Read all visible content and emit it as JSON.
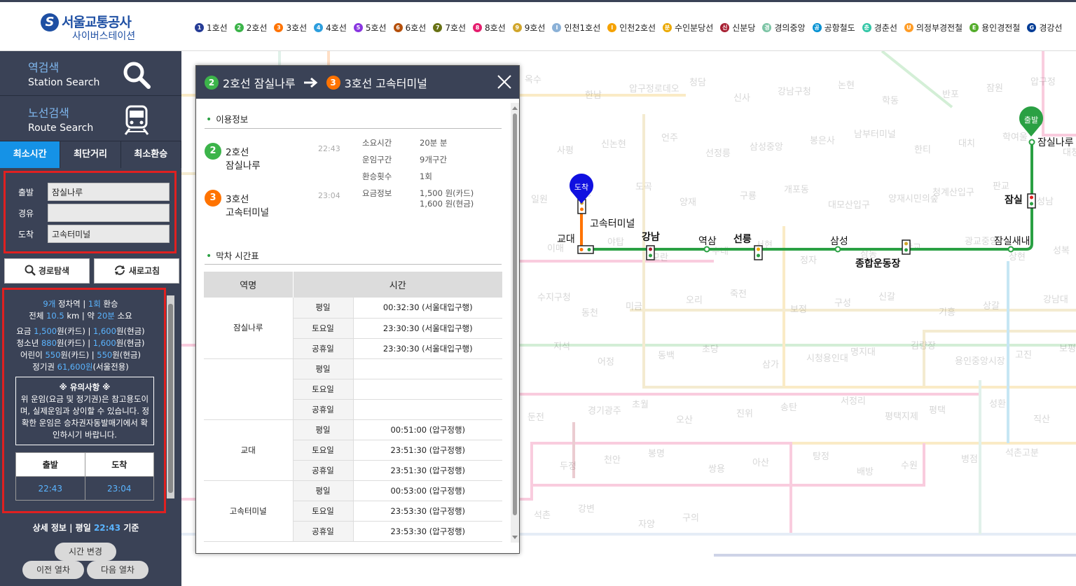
{
  "brand": {
    "title": "서울교통공사",
    "subtitle": "사이버스테이션",
    "mark": "S"
  },
  "lines": [
    {
      "badge": "1",
      "name": "1호선",
      "color": "#263c96"
    },
    {
      "badge": "2",
      "name": "2호선",
      "color": "#3cb44a"
    },
    {
      "badge": "3",
      "name": "3호선",
      "color": "#ff7300"
    },
    {
      "badge": "4",
      "name": "4호선",
      "color": "#2c9ede"
    },
    {
      "badge": "5",
      "name": "5호선",
      "color": "#8936e0"
    },
    {
      "badge": "6",
      "name": "6호선",
      "color": "#b5500b"
    },
    {
      "badge": "7",
      "name": "7호선",
      "color": "#697215"
    },
    {
      "badge": "8",
      "name": "8호선",
      "color": "#e51e6e"
    },
    {
      "badge": "9",
      "name": "9호선",
      "color": "#d1a62c"
    },
    {
      "badge": "I",
      "name": "인천1호선",
      "color": "#8bb1d7"
    },
    {
      "badge": "I",
      "name": "인천2호선",
      "color": "#f5a200"
    },
    {
      "badge": "분",
      "name": "수인분당선",
      "color": "#eba900"
    },
    {
      "badge": "신",
      "name": "신분당",
      "color": "#a71e31"
    },
    {
      "badge": "경",
      "name": "경의중앙",
      "color": "#7cc4a5"
    },
    {
      "badge": "공",
      "name": "공항철도",
      "color": "#0090d2"
    },
    {
      "badge": "춘",
      "name": "경춘선",
      "color": "#32c6a6"
    },
    {
      "badge": "U",
      "name": "의정부경전철",
      "color": "#ff9d27"
    },
    {
      "badge": "E",
      "name": "용인경전철",
      "color": "#56ad2d"
    },
    {
      "badge": "G",
      "name": "경강선",
      "color": "#003c96"
    }
  ],
  "sidebar": {
    "station_search": {
      "ko": "역검색",
      "en": "Station Search"
    },
    "route_search": {
      "ko": "노선검색",
      "en": "Route Search"
    },
    "tabs": [
      "최소시간",
      "최단거리",
      "최소환승"
    ],
    "form": {
      "from_label": "출발",
      "from_value": "잠실나루",
      "via_label": "경유",
      "via_value": "",
      "to_label": "도착",
      "to_value": "고속터미널"
    },
    "search_button": "경로탐색",
    "refresh_button": "새로고침",
    "result": {
      "stops": "9개",
      "stops_text": "정차역 |",
      "transfers": "1회",
      "transfers_text": "환승",
      "total_text": "전체",
      "distance": "10.5",
      "distance_unit": "km | 약",
      "duration": "20분",
      "duration_text": "소요",
      "fare_adult_label": "요금",
      "fare_adult_card": "1,500",
      "fare_adult_cash": "1,600",
      "fare_youth_label": "청소년",
      "fare_youth_card": "880",
      "fare_youth_cash": "1,600",
      "fare_child_label": "어린이",
      "fare_child_card": "550",
      "fare_child_cash": "550",
      "pass_label": "정기권",
      "pass_value": "61,600원",
      "pass_note": "(서울전용)",
      "card_unit": "원(카드) |",
      "cash_unit": "원(현금)",
      "notice_title": "※ 유의사항 ※",
      "notice_body": "위 운임(요금 및 정기권)은 참고용도이며, 실제운임과 상이할 수 있습니다. 정확한 운임은 승차권자동발매기에서 확인하시기 바랍니다.",
      "depart_label": "출발",
      "arrive_label": "도착",
      "depart_time": "22:43",
      "arrive_time": "23:04"
    },
    "detail": {
      "prefix": "상세 정보 | 평일",
      "time": "22:43",
      "suffix": "기준"
    },
    "change_time": "시간 변경",
    "prev_train": "이전 열차",
    "next_train": "다음 열차"
  },
  "popup": {
    "from_badge": "2",
    "from_line": "2호선 잠실나루",
    "to_badge": "3",
    "to_line": "3호선 고속터미널",
    "usage_title": "이용정보",
    "segments": [
      {
        "badge": "2",
        "line": "2호선",
        "station": "잠실나루",
        "time": "22:43"
      },
      {
        "badge": "3",
        "line": "3호선",
        "station": "고속터미널",
        "time": "23:04"
      }
    ],
    "info": [
      {
        "k": "소요시간",
        "v": "20분 분"
      },
      {
        "k": "운임구간",
        "v": "9개구간"
      },
      {
        "k": "환승횟수",
        "v": "1회"
      },
      {
        "k": "요금정보",
        "v": "1,500 원(카드)",
        "v2": "1,600 원(현금)"
      }
    ],
    "last_title": "막차 시간표",
    "table_headers": [
      "역명",
      "시간"
    ],
    "timetable": [
      {
        "station": "잠실나루",
        "rows": [
          {
            "day": "평일",
            "time": "00:32:30 (서울대입구행)"
          },
          {
            "day": "토요일",
            "time": "23:30:30 (서울대입구행)"
          },
          {
            "day": "공휴일",
            "time": "23:30:30 (서울대입구행)"
          }
        ]
      },
      {
        "station": "",
        "rows": [
          {
            "day": "평일",
            "time": ""
          },
          {
            "day": "토요일",
            "time": ""
          },
          {
            "day": "공휴일",
            "time": ""
          }
        ]
      },
      {
        "station": "교대",
        "rows": [
          {
            "day": "평일",
            "time": "00:51:00 (압구정행)"
          },
          {
            "day": "토요일",
            "time": "23:51:30 (압구정행)"
          },
          {
            "day": "공휴일",
            "time": "23:51:30 (압구정행)"
          }
        ]
      },
      {
        "station": "고속터미널",
        "rows": [
          {
            "day": "평일",
            "time": "00:53:00 (압구정행)"
          },
          {
            "day": "토요일",
            "time": "23:53:30 (압구정행)"
          },
          {
            "day": "공휴일",
            "time": "23:53:30 (압구정행)"
          }
        ]
      }
    ]
  },
  "map": {
    "arrive_marker": "도착",
    "depart_marker": "출발",
    "route_stations": [
      "잠실나루",
      "잠실",
      "잠실새내",
      "종합운동장",
      "삼성",
      "선릉",
      "역삼",
      "강남",
      "교대",
      "고속터미널"
    ],
    "bg_stations": [
      "옥수",
      "한남",
      "압구정로데오",
      "청담",
      "신사",
      "강남구청",
      "논현",
      "학동",
      "반포",
      "잠원",
      "압구정",
      "사평",
      "신논현",
      "언주",
      "선정릉",
      "삼성중앙",
      "봉은사",
      "남부터미널",
      "한티",
      "대치",
      "학여울",
      "대청",
      "일원",
      "매봉",
      "도곡",
      "양재",
      "구룡",
      "개포동",
      "대모산입구",
      "양재시민의숲",
      "청계산입구",
      "판교",
      "성남",
      "이매",
      "야탑",
      "모란",
      "수내",
      "서현",
      "정자",
      "삼동",
      "광교",
      "광교중앙",
      "상현",
      "성복",
      "수지구청",
      "동천",
      "미금",
      "오리",
      "죽전",
      "보정",
      "구성",
      "신갈",
      "기흥",
      "상갈",
      "강남대",
      "지석",
      "어정",
      "동백",
      "초당",
      "삼가",
      "시청용인대",
      "명지대",
      "김량장",
      "용인중앙시장",
      "고진",
      "보평",
      "둔전",
      "경기광주",
      "초월",
      "오산",
      "진위",
      "송탄",
      "서정리",
      "평택지제",
      "평택",
      "성환",
      "직산",
      "두정",
      "천안",
      "봉명",
      "쌍용",
      "아산",
      "탕정",
      "배방",
      "수원",
      "병점",
      "석촌고분",
      "삼전",
      "석촌",
      "강변",
      "자양",
      "구의"
    ]
  }
}
